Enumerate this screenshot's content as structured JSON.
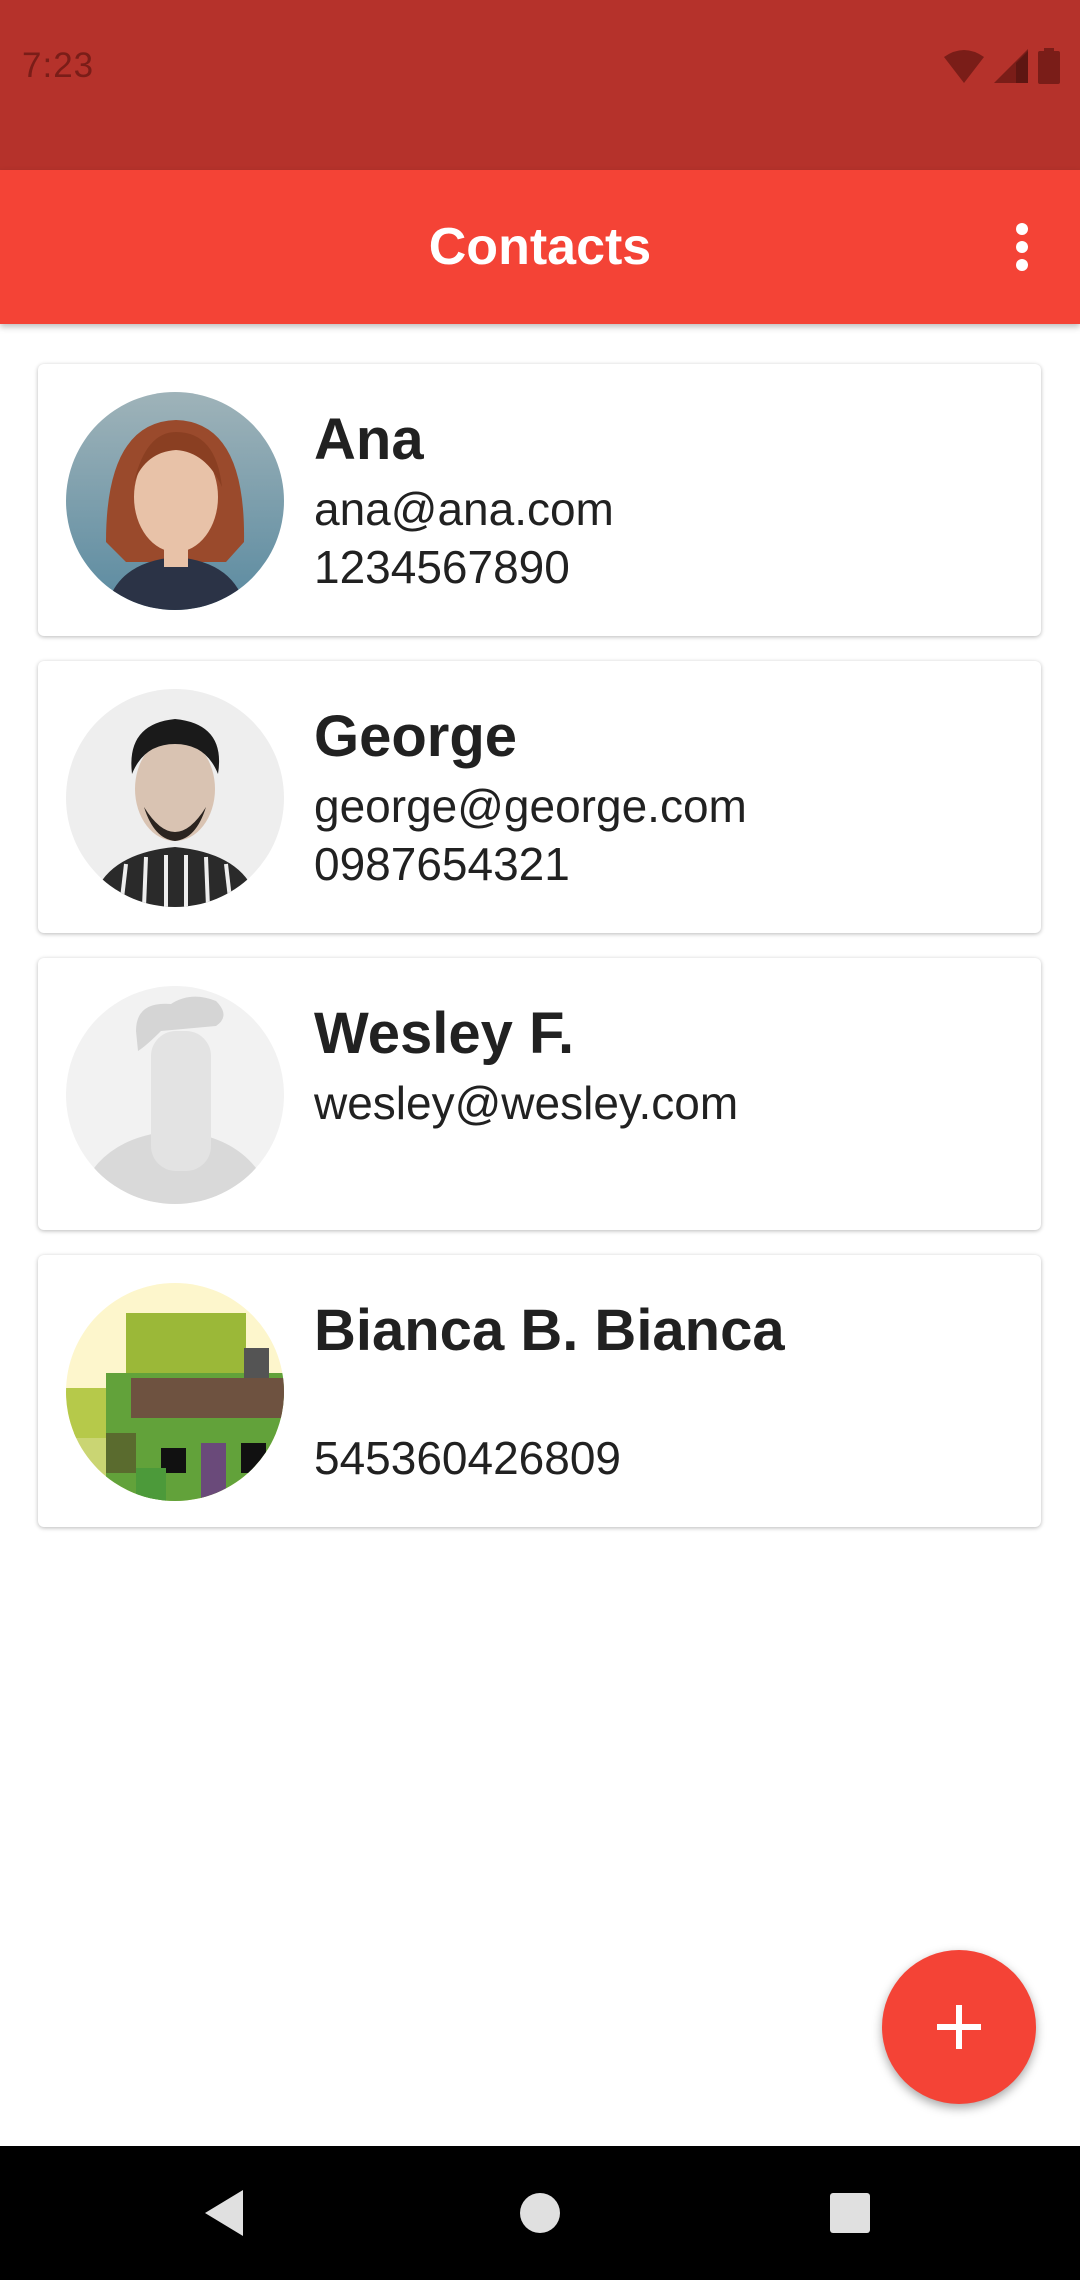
{
  "status_bar": {
    "time": "7:23",
    "icons": [
      "wifi-icon",
      "cell-signal-icon",
      "battery-icon"
    ]
  },
  "app_bar": {
    "title": "Contacts",
    "menu_icon": "more-vert-icon",
    "color": "#f44336",
    "status_color": "#b5322b"
  },
  "contacts": [
    {
      "name": "Ana",
      "email": "ana@ana.com",
      "phone": "1234567890",
      "avatar": "photo-woman-red-hair"
    },
    {
      "name": "George",
      "email": "george@george.com",
      "phone": "0987654321",
      "avatar": "photo-man-beard"
    },
    {
      "name": "Wesley F.",
      "email": "wesley@wesley.com",
      "phone": "",
      "avatar": "placeholder-person"
    },
    {
      "name": "Bianca B. Bianca",
      "email": "",
      "phone": "545360426809",
      "avatar": "pixel-art"
    }
  ],
  "fab": {
    "icon": "plus-icon"
  },
  "nav_bar": {
    "icons": [
      "back-icon",
      "home-icon",
      "recents-icon"
    ]
  }
}
